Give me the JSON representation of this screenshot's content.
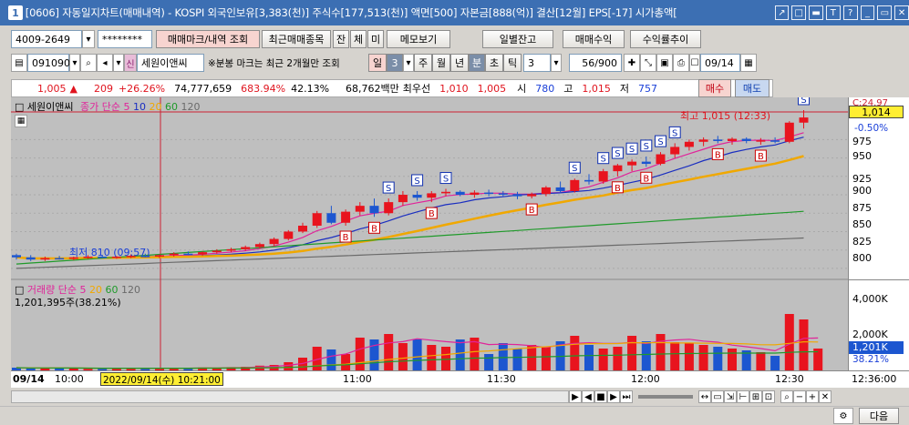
{
  "titlebar": {
    "num": "1",
    "title": "[0606] 자동일지차트(매매내역) - KOSPI 외국인보유[3,383(천)] 주식수[177,513(천)] 액면[500] 자본금[888(억)] 결산[12월] EPS[-17] 시가총액[",
    "buttons": [
      "↗",
      "□",
      "▬",
      "T",
      "?",
      "_",
      "▭",
      "✕"
    ]
  },
  "toolbar1": {
    "account": "4009-2649",
    "password": "********",
    "btn_trade_mark": "매매마크/내역 조회",
    "btn_recent": "최근매매종목",
    "btn_balance": "잔",
    "btn_conclusion": "체",
    "btn_order": "미",
    "btn_memo": "메모보기",
    "btn_daily_balance": "일별잔고",
    "btn_trade_profit": "매매수익",
    "btn_return_trend": "수익률추이"
  },
  "toolbar2": {
    "code": "091090",
    "stock_name": "세원이앤씨",
    "notice": "※분봉 마크는 최근 2개월만 조회",
    "period_day": "일",
    "period_num": "3",
    "period_week": "주",
    "period_month": "월",
    "period_year": "년",
    "period_min": "분",
    "period_sec": "초",
    "period_tick": "틱",
    "interval": "3",
    "count": "56/900",
    "date": "09/14"
  },
  "quote": {
    "price": "1,005",
    "arrow": "▲",
    "change": "209",
    "change_pct": "+26.26%",
    "volume": "74,777,659",
    "vol_ratio": "683.94%",
    "turnover": "42.13%",
    "amount": "68,762백만",
    "ask_label": "최우선",
    "ask": "1,010",
    "bid": "1,005",
    "open_label": "시",
    "open": "780",
    "high_label": "고",
    "high": "1,015",
    "low_label": "저",
    "low": "757",
    "buy": "매수",
    "sell": "매도"
  },
  "price_legend": {
    "name": "세원이앤씨",
    "ma_label": "종가 단순 5",
    "ma10": "10",
    "ma20": "20",
    "ma60": "60",
    "ma120": "120"
  },
  "volume_legend": {
    "name": "거래량",
    "ma_label": "단순 5",
    "ma20": "20",
    "ma60": "60",
    "ma120": "120",
    "current": "1,201,395주(38.21%)"
  },
  "annotations": {
    "high": "최고 1,015 (12:33)",
    "low": "최저 810 (09:57)"
  },
  "yaxis_price": {
    "ticks": [
      "975",
      "950",
      "925",
      "900",
      "875",
      "850",
      "825",
      "800"
    ],
    "current": "1,014",
    "current_pct": "-0.50%",
    "top_partial": "C:24.97"
  },
  "yaxis_volume": {
    "ticks": [
      "4,000K",
      "2,000K"
    ],
    "current": "1,201K",
    "current_pct": "38.21%"
  },
  "xaxis": {
    "date": "09/14",
    "cursor": "2022/09/14(수) 10:21:00",
    "labels": [
      "10:00",
      "11:00",
      "11:30",
      "12:00",
      "12:30"
    ],
    "end": "12:36:00"
  },
  "footer": {
    "close": "다음"
  },
  "colors": {
    "up": "#e8141e",
    "down": "#1c56d0",
    "ma5": "#e0249a",
    "ma10": "#1a2ec0",
    "ma20": "#f0a800",
    "ma60": "#1f9a2a",
    "ma120": "#6a6a6a"
  },
  "chart_data": {
    "type": "candlestick",
    "price_range": [
      790,
      1015
    ],
    "candles": [
      [
        818,
        820,
        812,
        815
      ],
      [
        815,
        818,
        810,
        812
      ],
      [
        812,
        816,
        810,
        814
      ],
      [
        814,
        817,
        812,
        813
      ],
      [
        813,
        816,
        811,
        815
      ],
      [
        815,
        818,
        813,
        816
      ],
      [
        816,
        818,
        814,
        815
      ],
      [
        815,
        817,
        813,
        816
      ],
      [
        816,
        819,
        814,
        817
      ],
      [
        817,
        820,
        815,
        816
      ],
      [
        816,
        819,
        814,
        818
      ],
      [
        818,
        822,
        816,
        820
      ],
      [
        820,
        823,
        818,
        819
      ],
      [
        819,
        823,
        817,
        822
      ],
      [
        822,
        826,
        820,
        824
      ],
      [
        824,
        828,
        822,
        826
      ],
      [
        826,
        831,
        824,
        829
      ],
      [
        829,
        835,
        827,
        833
      ],
      [
        833,
        842,
        830,
        840
      ],
      [
        840,
        852,
        838,
        850
      ],
      [
        850,
        862,
        848,
        858
      ],
      [
        858,
        878,
        855,
        875
      ],
      [
        875,
        885,
        860,
        862
      ],
      [
        862,
        880,
        858,
        877
      ],
      [
        877,
        890,
        872,
        885
      ],
      [
        885,
        895,
        870,
        875
      ],
      [
        875,
        895,
        872,
        890
      ],
      [
        890,
        905,
        885,
        900
      ],
      [
        900,
        905,
        892,
        896
      ],
      [
        896,
        905,
        890,
        902
      ],
      [
        902,
        908,
        898,
        904
      ],
      [
        904,
        906,
        898,
        900
      ],
      [
        900,
        906,
        896,
        903
      ],
      [
        903,
        907,
        898,
        902
      ],
      [
        902,
        905,
        897,
        901
      ],
      [
        901,
        904,
        894,
        898
      ],
      [
        898,
        903,
        895,
        901
      ],
      [
        901,
        912,
        898,
        910
      ],
      [
        910,
        918,
        902,
        905
      ],
      [
        905,
        922,
        903,
        920
      ],
      [
        920,
        928,
        914,
        918
      ],
      [
        918,
        935,
        915,
        932
      ],
      [
        932,
        942,
        925,
        940
      ],
      [
        940,
        948,
        932,
        945
      ],
      [
        945,
        952,
        938,
        942
      ],
      [
        942,
        958,
        940,
        955
      ],
      [
        955,
        970,
        950,
        965
      ],
      [
        965,
        975,
        960,
        972
      ],
      [
        972,
        978,
        966,
        975
      ],
      [
        975,
        980,
        970,
        973
      ],
      [
        973,
        978,
        968,
        976
      ],
      [
        976,
        978,
        970,
        973
      ],
      [
        973,
        977,
        968,
        974
      ],
      [
        974,
        978,
        970,
        972
      ],
      [
        972,
        1000,
        970,
        998
      ],
      [
        998,
        1015,
        990,
        1005
      ]
    ],
    "volumes": [
      150,
      120,
      140,
      110,
      130,
      90,
      100,
      120,
      110,
      130,
      100,
      140,
      120,
      160,
      150,
      180,
      200,
      260,
      300,
      450,
      700,
      1300,
      1150,
      900,
      1800,
      1700,
      2000,
      1500,
      1700,
      1400,
      1300,
      1700,
      1800,
      900,
      1500,
      1200,
      1400,
      1300,
      1600,
      1900,
      1400,
      1200,
      1300,
      1900,
      1600,
      2000,
      1550,
      1500,
      1400,
      1300,
      1200,
      1100,
      1000,
      800,
      3100,
      2800,
      1201
    ],
    "volume_max": 4500
  }
}
